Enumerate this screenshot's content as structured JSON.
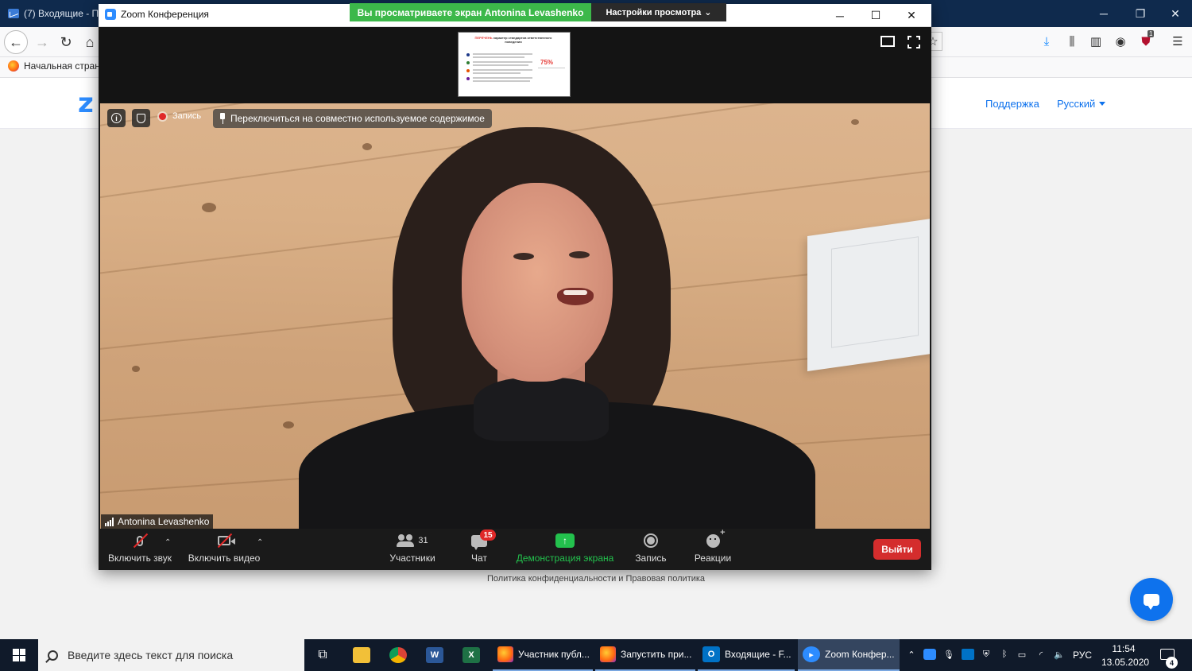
{
  "browser": {
    "tab_title": "(7) Входящие - П",
    "bookmark_label": "Начальная стран",
    "toolbar_badge_count": "1"
  },
  "website": {
    "logo_fragment": "z",
    "support_link": "Поддержка",
    "language_link": "Русский",
    "footer_link": "Политика конфиденциальности и Правовая политика"
  },
  "zoom": {
    "window_title": "Zoom Конференция",
    "viewing_banner": "Вы просматриваете экран Antonina Levashenko",
    "view_options": "Настройки просмотра",
    "shared_thumbnail": {
      "heading_red": "ПЕРЕЧЕНЬ",
      "heading": "характер стандартов ответственного поведения",
      "percent": "75%"
    },
    "recording_label": "Запись",
    "switch_share_label": "Переключиться на совместно используемое содержимое",
    "participant_name": "Antonina Levashenko",
    "toolbar": {
      "unmute_label": "Включить звук",
      "start_video_label": "Включить видео",
      "participants_label": "Участники",
      "participants_count": "31",
      "chat_label": "Чат",
      "chat_badge": "15",
      "share_label": "Демонстрация экрана",
      "record_label": "Запись",
      "reactions_label": "Реакции",
      "leave_label": "Выйти"
    },
    "colors": {
      "banner_green": "#3cb84a",
      "share_green": "#23c14d",
      "leave_red": "#d42d2d",
      "zoom_blue": "#2d8cff"
    }
  },
  "taskbar": {
    "search_placeholder": "Введите здесь текст для поиска",
    "apps": [
      {
        "label": "Участник публ...",
        "icon": "firefox-icon"
      },
      {
        "label": "Запустить при...",
        "icon": "firefox-icon"
      },
      {
        "label": "Входящие - F...",
        "icon": "outlook-icon"
      },
      {
        "label": "Zoom Конфер...",
        "icon": "zoom-icon"
      }
    ],
    "language": "РУС",
    "time": "11:54",
    "date": "13.05.2020",
    "notifications": "4"
  }
}
